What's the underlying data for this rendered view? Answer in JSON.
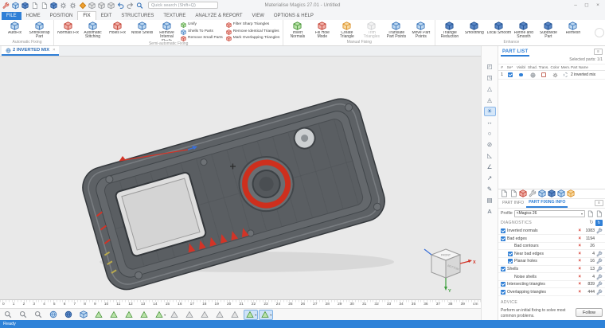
{
  "window": {
    "title": "Materialise Magics 27.01 - Untitled",
    "controls": [
      {
        "name": "minimize-button",
        "glyph": "–"
      },
      {
        "name": "maximize-button",
        "glyph": "◻"
      },
      {
        "name": "close-button",
        "glyph": "×"
      }
    ]
  },
  "icons": {
    "error": "×",
    "menu": "≡",
    "refresh": "↻",
    "dropdown": "▾",
    "close": "×"
  },
  "qat": {
    "search_placeholder": "Quick search (Shift+Q)",
    "items": [
      {
        "name": "fix-wizard-icon",
        "k": "wrench",
        "col": "red"
      },
      {
        "name": "new-scene-icon",
        "k": "cube",
        "col": "blue"
      },
      {
        "name": "machine-icon",
        "k": "cube",
        "col": "dark"
      },
      {
        "name": "import-part-icon",
        "k": "page"
      },
      {
        "name": "export-platform-icon",
        "k": "page"
      },
      {
        "name": "build-icon",
        "k": "cube",
        "col": "dark"
      },
      {
        "name": "settings-icon",
        "k": "gear",
        "col": "gray"
      },
      {
        "name": "preferences-icon",
        "k": "gear",
        "col": "gray"
      },
      {
        "name": "support-generation-icon",
        "k": "diamond",
        "col": "orange"
      },
      {
        "name": "annotations-page-icon",
        "k": "cube",
        "col": "gray"
      },
      {
        "name": "measurements-page-icon",
        "k": "cube",
        "col": "gray"
      },
      {
        "name": "report-page-icon",
        "k": "cube",
        "col": "gray"
      },
      {
        "name": "undo-icon",
        "k": "undo",
        "col": "blue"
      },
      {
        "name": "redo-icon",
        "k": "redo",
        "col": "gray"
      },
      {
        "name": "search-part-icon",
        "k": "mag",
        "col": "blue"
      }
    ]
  },
  "menu": {
    "tabs": [
      {
        "name": "tab-file",
        "label": "FILE",
        "file": true
      },
      {
        "name": "tab-home",
        "label": "HOME"
      },
      {
        "name": "tab-position",
        "label": "POSITION"
      },
      {
        "name": "tab-fix",
        "label": "FIX",
        "active": true
      },
      {
        "name": "tab-edit",
        "label": "EDIT"
      },
      {
        "name": "tab-structures",
        "label": "STRUCTURES"
      },
      {
        "name": "tab-texture",
        "label": "TEXTURE"
      },
      {
        "name": "tab-analyze-report",
        "label": "ANALYZE & REPORT"
      },
      {
        "name": "tab-view",
        "label": "VIEW"
      },
      {
        "name": "tab-options-help",
        "label": "OPTIONS & HELP"
      }
    ]
  },
  "ribbon": {
    "groups": [
      {
        "name": "Automatic Fixing",
        "items": [
          {
            "name": "autofix-button",
            "label": "AutoFix",
            "col": "blue"
          },
          {
            "name": "shrinkwrap-part-button",
            "label": "ShrinkWrap Part",
            "col": "blue"
          }
        ]
      },
      {
        "name": "Semi-automatic Fixing",
        "items": [
          {
            "name": "normals-fix-button",
            "label": "Normals Fix",
            "col": "red"
          },
          {
            "name": "automatic-stitching-button",
            "label": "Automatic Stitching",
            "col": "blue"
          },
          {
            "name": "holes-fix-button",
            "label": "Holes Fix",
            "col": "red"
          },
          {
            "name": "noise-shells-button",
            "label": "Noise Shells",
            "col": "blue"
          },
          {
            "name": "remove-internal-shells-button",
            "label": "Remove Internal Shells",
            "col": "blue"
          }
        ],
        "smalls1": [
          {
            "name": "unify-button",
            "label": "Unify",
            "col": "green"
          },
          {
            "name": "shells-to-parts-button",
            "label": "Shells To Parts",
            "col": "blue"
          },
          {
            "name": "remove-small-parts-button",
            "label": "Remove Small Parts",
            "col": "red"
          }
        ],
        "smalls2": [
          {
            "name": "filter-sharp-triangles-button",
            "label": "Filter Sharp Triangles",
            "col": "red"
          },
          {
            "name": "remove-identical-triangles-button",
            "label": "Remove Identical Triangles",
            "col": "red"
          },
          {
            "name": "mark-overlapping-triangles-button",
            "label": "Mark Overlapping Triangles",
            "col": "red"
          }
        ]
      },
      {
        "name": "Manual Fixing",
        "items": [
          {
            "name": "invert-normals-button",
            "label": "Invert Normals",
            "col": "green"
          },
          {
            "name": "fill-hole-mode-button",
            "label": "Fill Hole Mode",
            "col": "red"
          },
          {
            "name": "create-triangle-button",
            "label": "Create Triangle",
            "col": "orange"
          },
          {
            "name": "trim-triangles-button",
            "label": "Trim Triangles",
            "col": "gray",
            "disabled": true
          },
          {
            "name": "translate-part-points-button",
            "label": "Translate Part Points",
            "col": "blue"
          },
          {
            "name": "move-part-points-button",
            "label": "Move Part Points",
            "col": "blue"
          }
        ]
      },
      {
        "name": "Enhance",
        "items": [
          {
            "name": "triangle-reduction-button",
            "label": "Triangle Reduction",
            "col": "dark"
          },
          {
            "name": "smoothing-button",
            "label": "Smoothing",
            "col": "dark"
          },
          {
            "name": "local-smooth-button",
            "label": "Local Smooth",
            "col": "dark"
          },
          {
            "name": "refine-and-smooth-button",
            "label": "Refine and Smooth",
            "col": "dark"
          },
          {
            "name": "subdivide-part-button",
            "label": "Subdivide Part",
            "col": "dark"
          },
          {
            "name": "remesh-button",
            "label": "Remesh",
            "col": "blue"
          }
        ]
      }
    ]
  },
  "scene_tab": {
    "label": "2 INVERTED MIX"
  },
  "right_toolbar": {
    "icons": [
      {
        "name": "zoom-view-icon",
        "glyph": "◰"
      },
      {
        "name": "unzoom-view-icon",
        "glyph": "◳"
      },
      {
        "name": "marked-triangles-view-icon",
        "glyph": "△"
      },
      {
        "name": "zoom-marked-icon",
        "glyph": "◬"
      },
      {
        "name": "brightness-icon",
        "glyph": "☀",
        "sel": true
      },
      {
        "name": "measure-distance-icon",
        "glyph": "↔"
      },
      {
        "name": "measure-circle-icon",
        "glyph": "○"
      },
      {
        "name": "measure-diameter-icon",
        "glyph": "⊘"
      },
      {
        "name": "measure-triangle-icon",
        "glyph": "◺"
      },
      {
        "name": "measure-angle-icon",
        "glyph": "∠"
      },
      {
        "name": "annotation-arrow-icon",
        "glyph": "↗"
      },
      {
        "name": "annotation-pencil-icon",
        "glyph": "✎"
      },
      {
        "name": "annotation-note-icon",
        "glyph": "▤"
      },
      {
        "name": "annotation-text-icon",
        "glyph": "A"
      }
    ]
  },
  "part_list": {
    "title": "PART LIST",
    "selected": "Selected parts: 1/1",
    "columns": [
      "#",
      "Se*",
      "Visibl",
      "Shad.",
      "Trans.",
      "Color",
      "Mem.",
      "Part Name"
    ],
    "row": {
      "num": "1",
      "name": "2 inverted mix"
    }
  },
  "part_tools": {
    "icons": [
      {
        "name": "part-save-icon",
        "k": "page"
      },
      {
        "name": "part-duplicate-icon",
        "k": "page"
      },
      {
        "name": "part-delete-icon",
        "k": "cube",
        "col": "red"
      },
      {
        "name": "part-fix-icon",
        "k": "wrench",
        "col": "gray"
      },
      {
        "name": "part-orient-icon",
        "k": "cube",
        "col": "blue"
      },
      {
        "name": "part-supports-icon",
        "k": "cube",
        "col": "dark"
      },
      {
        "name": "part-slice-icon",
        "k": "cube",
        "col": "blue"
      },
      {
        "name": "part-export-icon",
        "k": "cube",
        "col": "orange"
      }
    ]
  },
  "info_tabs": {
    "part_info": "PART INFO",
    "part_fixing_info": "PART FIXING INFO"
  },
  "profile": {
    "label": "Profile",
    "value": "<Magics 26"
  },
  "diagnostics": {
    "title": "DIAGNOSTICS",
    "rows": [
      {
        "label": "Inverted normals",
        "count": 1083,
        "check": true,
        "wrench": true
      },
      {
        "label": "Bad edges",
        "count": 1194,
        "check": true,
        "wrench": false
      },
      {
        "label": "Bad contours",
        "count": 26,
        "check": false,
        "indent": true,
        "wrench": false
      },
      {
        "label": "Near bad edges",
        "count": 4,
        "check": true,
        "indent": true,
        "wrench": true
      },
      {
        "label": "Planar holes",
        "count": 16,
        "check": true,
        "indent": true,
        "wrench": true
      },
      {
        "label": "Shells",
        "count": 13,
        "check": true,
        "wrench": true
      },
      {
        "label": "Noise shells",
        "count": 4,
        "check": false,
        "indent": true,
        "wrench": true
      },
      {
        "label": "Intersecting triangles",
        "count": 839,
        "check": true,
        "wrench": true
      },
      {
        "label": "Overlapping triangles",
        "count": 444,
        "check": true,
        "wrench": true
      }
    ]
  },
  "advice": {
    "title": "ADVICE",
    "text": "Perform an initial fixing to solve most common problems.",
    "button": "Follow"
  },
  "ruler": {
    "labels": [
      "0",
      "1",
      "2",
      "3",
      "4",
      "5",
      "6",
      "7",
      "8",
      "9",
      "10",
      "11",
      "12",
      "13",
      "14",
      "15",
      "16",
      "17",
      "18",
      "19",
      "20",
      "21",
      "22",
      "23",
      "24",
      "25",
      "26",
      "27",
      "28",
      "29",
      "30",
      "31",
      "32",
      "33",
      "34",
      "35",
      "36",
      "37",
      "38",
      "39",
      "cm"
    ]
  },
  "bottom_toolbar": {
    "icons": [
      {
        "name": "zoom-icon",
        "k": "mag",
        "col": "gray"
      },
      {
        "name": "zoom-box-icon",
        "k": "mag",
        "col": "gray"
      },
      {
        "name": "zoom-selection-icon",
        "k": "mag",
        "col": "gray"
      },
      {
        "name": "pan-view-icon",
        "k": "sphere",
        "col": "blue"
      },
      {
        "name": "rotate-view-icon",
        "k": "sphere",
        "col": "dark"
      },
      {
        "name": "default-views-icon",
        "k": "cube",
        "col": "blue"
      },
      {
        "name": "mark-triangle-icon",
        "k": "tri",
        "col": "green"
      },
      {
        "name": "mark-plane-icon",
        "k": "tri",
        "col": "green"
      },
      {
        "name": "mark-surface-icon",
        "k": "tri",
        "col": "green"
      },
      {
        "name": "mark-shell-icon",
        "k": "tri",
        "col": "green"
      },
      {
        "name": "mark-window-icon",
        "k": "tri",
        "col": "green",
        "dd": true
      },
      {
        "name": "mark-brush-icon",
        "k": "tri",
        "col": "gray"
      },
      {
        "name": "mark-inside-icon",
        "k": "tri",
        "col": "gray"
      },
      {
        "name": "mark-outside-icon",
        "k": "tri",
        "col": "gray"
      },
      {
        "name": "mark-plane-section-icon",
        "k": "tri",
        "col": "gray"
      },
      {
        "name": "mark-through-icon",
        "k": "tri",
        "col": "gray"
      },
      {
        "name": "select-triangles-icon",
        "k": "tri",
        "col": "green",
        "sel": true,
        "dd": true
      },
      {
        "name": "select-shells-icon",
        "k": "tri",
        "col": "green",
        "sel": true,
        "dd": true
      }
    ]
  },
  "statusbar": {
    "ready": "Ready"
  }
}
